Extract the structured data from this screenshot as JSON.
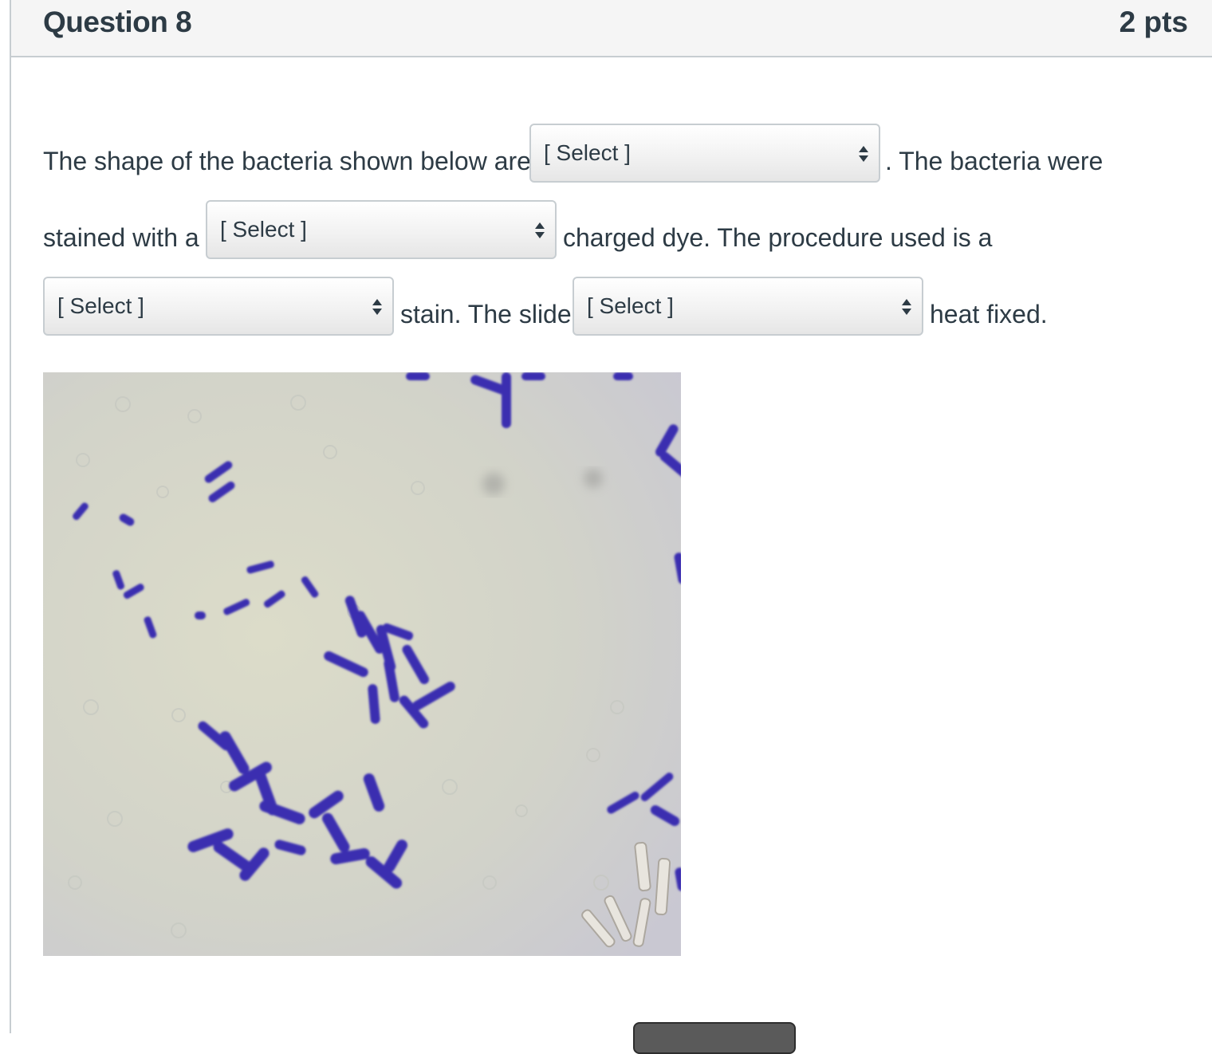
{
  "question": {
    "title": "Question 8",
    "points": "2 pts"
  },
  "body": {
    "text_1": "The shape of the bacteria shown below are",
    "text_2": ". The bacteria were",
    "text_3": "stained with a",
    "text_4": "charged dye. The procedure used is a",
    "text_5": "stain. The slide",
    "text_6": "heat fixed."
  },
  "dropdowns": [
    {
      "selected": "[ Select ]"
    },
    {
      "selected": "[ Select ]"
    },
    {
      "selected": "[ Select ]"
    },
    {
      "selected": "[ Select ]"
    }
  ],
  "image": {
    "icon": "micrograph-stained-rod-bacteria",
    "colors": {
      "background": "#d5d6c6",
      "stain": "#3a2fb0"
    }
  },
  "colors": {
    "header_bg": "#f5f5f5",
    "border": "#c7cdd1",
    "text": "#2d3b45"
  }
}
